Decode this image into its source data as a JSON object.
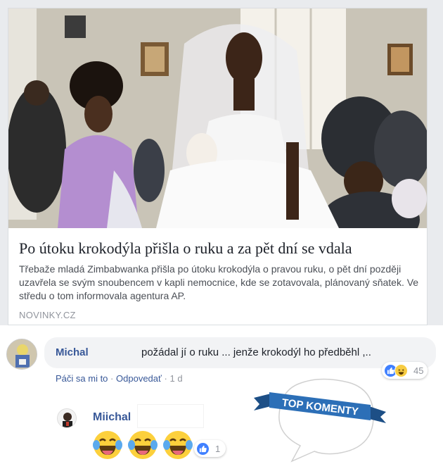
{
  "card": {
    "title": "Po útoku krokodýla přišla o ruku a za pět dní se vdala",
    "description": "Třebaže mladá Zimbabwanka přišla po útoku krokodýla o pravou ruku, o pět dní později uzavřela se svým snoubencem v kapli nemocnice, kde se zotavovala, plánovaný sňatek. Ve středu o tom informovala agentura AP.",
    "source": "NOVINKY.CZ"
  },
  "comment": {
    "author": "Michal",
    "text": "požádal jí o ruku ... jenže krokodýl ho předběhl ,..",
    "reaction_count": "45",
    "actions": {
      "like": "Páči sa mi to",
      "separator": "·",
      "reply": "Odpovedať",
      "time": "1 d"
    }
  },
  "reply": {
    "author": "Miichal",
    "emojis": [
      "laughing-crying",
      "laughing-crying",
      "laughing-crying"
    ],
    "reaction_count": "1"
  },
  "sticker": {
    "text": "TOP KOMENTY"
  },
  "colors": {
    "link": "#385898",
    "like": "#4080ff",
    "haha": "#f7cc42",
    "ribbon": "#2c6fb7"
  }
}
